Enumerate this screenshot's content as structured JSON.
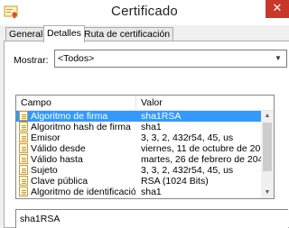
{
  "window": {
    "title": "Certificado",
    "close_glyph": "✕",
    "app_icon": "certificate-icon"
  },
  "tabs": [
    {
      "label": "General",
      "active": false
    },
    {
      "label": "Detalles",
      "active": true
    },
    {
      "label": "Ruta de certificación",
      "active": false
    }
  ],
  "show": {
    "label": "Mostrar:",
    "selected": "<Todos>",
    "arrow_glyph": "▼"
  },
  "list": {
    "columns": [
      "Campo",
      "Valor"
    ],
    "selected_index": 0,
    "rows": [
      {
        "field": "Algoritmo de firma",
        "value": "sha1RSA"
      },
      {
        "field": "Algoritmo hash de firma",
        "value": "sha1"
      },
      {
        "field": "Emisor",
        "value": "3, 3, 2, 432r54, 45, us"
      },
      {
        "field": "Válido desde",
        "value": "viernes, 11 de octubre de 201..."
      },
      {
        "field": "Válido hasta",
        "value": "martes, 26 de febrero de 204..."
      },
      {
        "field": "Sujeto",
        "value": "3, 3, 2, 432r54, 45, us"
      },
      {
        "field": "Clave pública",
        "value": "RSA (1024 Bits)"
      },
      {
        "field": "Algoritmo de identificación...",
        "value": "sha1"
      }
    ],
    "scroll_up_glyph": "▲",
    "scroll_down_glyph": "▼"
  },
  "detail": {
    "text": "sha1RSA"
  },
  "colors": {
    "selection": "#3399ff",
    "close_button": "#c7382b",
    "dialog_bg": "#f0f0f0"
  }
}
